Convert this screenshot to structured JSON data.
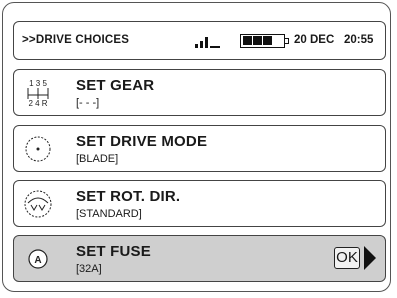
{
  "header": {
    "title": ">>DRIVE CHOICES",
    "date": "20 DEC",
    "time": "20:55"
  },
  "status": {
    "signal_bars": 3,
    "battery_cells_filled": 3,
    "battery_cells_total": 4
  },
  "menu": {
    "items": [
      {
        "label": "SET GEAR",
        "value": "[- - -]",
        "icon": "gearshift-icon",
        "selected": false
      },
      {
        "label": "SET DRIVE MODE",
        "value": "[BLADE]",
        "icon": "blade-disc-icon",
        "selected": false
      },
      {
        "label": "SET ROT. DIR.",
        "value": "[STANDARD]",
        "icon": "rotation-direction-icon",
        "selected": false
      },
      {
        "label": "SET FUSE",
        "value": "[32A]",
        "icon": "fuse-icon",
        "selected": true
      }
    ],
    "gear_icon_labels": {
      "top": "1 3 5",
      "bottom": "2 4 R"
    },
    "fuse_icon_letter": "A",
    "ok_label": "OK"
  }
}
